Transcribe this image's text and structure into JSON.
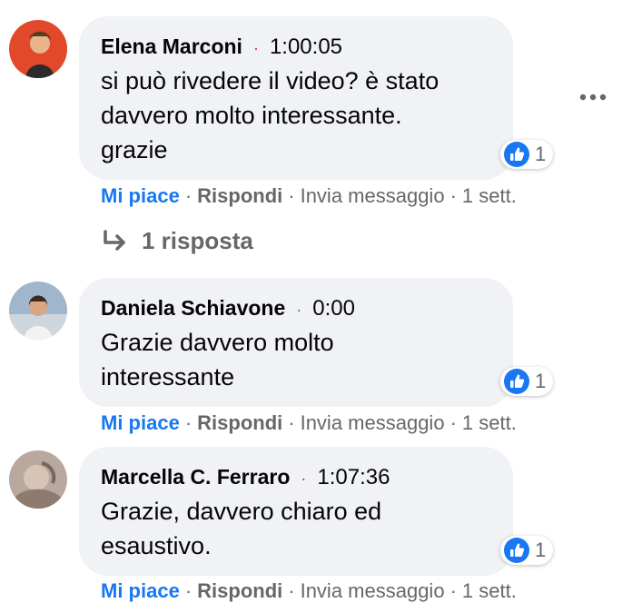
{
  "more_options": "more-horizontal-icon",
  "comments": [
    {
      "author": "Elena Marconi",
      "dot_color": "#e4245b",
      "timestamp": "1:00:05",
      "text_lines": [
        "si può rivedere il video? è stato",
        "davvero molto interessante.",
        "grazie"
      ],
      "reaction_count": "1",
      "actions": {
        "like": "Mi piace",
        "reply": "Rispondi",
        "message": "Invia messaggio",
        "time": "1 sett."
      }
    },
    {
      "author": "Daniela Schiavone",
      "dot_color": "#65676b",
      "timestamp": "0:00",
      "text_lines": [
        "Grazie davvero molto",
        "interessante"
      ],
      "reaction_count": "1",
      "actions": {
        "like": "Mi piace",
        "reply": "Rispondi",
        "message": "Invia messaggio",
        "time": "1 sett."
      }
    },
    {
      "author": "Marcella C. Ferraro",
      "dot_color": "#e4245b",
      "timestamp": "1:07:36",
      "text_lines": [
        "Grazie, davvero chiaro ed",
        "esaustivo."
      ],
      "reaction_count": "1",
      "actions": {
        "like": "Mi piace",
        "reply": "Rispondi",
        "message": "Invia messaggio",
        "time": "1 sett."
      }
    }
  ],
  "replies_link": "1 risposta",
  "colors": {
    "link_blue": "#1877f2",
    "bubble_bg": "#f0f2f5",
    "muted": "#65676b"
  }
}
